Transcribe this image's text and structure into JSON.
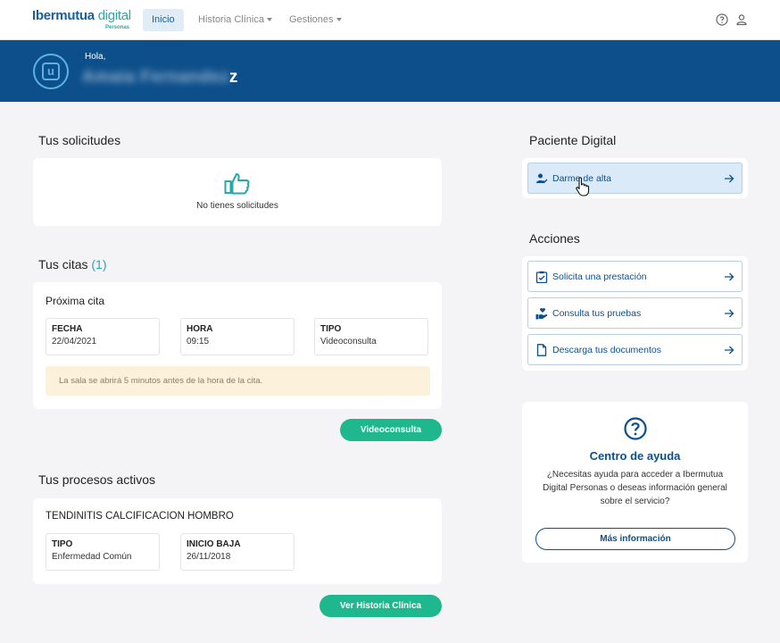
{
  "nav": {
    "logo_brand": "Ibermutua",
    "logo_digital": "digital",
    "logo_sub": "Personas",
    "items": [
      {
        "label": "Inicio",
        "active": true
      },
      {
        "label": "Historia Clínica"
      },
      {
        "label": "Gestiones"
      }
    ],
    "icons": [
      "help-circle-icon",
      "user-icon"
    ]
  },
  "banner": {
    "greeting": "Hola,",
    "name_blurred": "Amaia Fernandez",
    "name_visible_tail": "z"
  },
  "solicitudes": {
    "title": "Tus solicitudes",
    "empty_text": "No tienes solicitudes",
    "icon": "thumbs-up-icon"
  },
  "citas": {
    "title": "Tus citas",
    "count": "(1)",
    "next_title": "Próxima cita",
    "fields": [
      {
        "label": "FECHA",
        "value": "22/04/2021"
      },
      {
        "label": "HORA",
        "value": "09:15"
      },
      {
        "label": "TIPO",
        "value": "Videoconsulta"
      }
    ],
    "notice": "La sala se abrirá 5 minutos antes de la hora de la cita.",
    "button": "Videoconsulta"
  },
  "procesos": {
    "title": "Tus procesos activos",
    "process_name": "TENDINITIS CALCIFICACION HOMBRO",
    "fields": [
      {
        "label": "TIPO",
        "value": "Enfermedad Común"
      },
      {
        "label": "INICIO BAJA",
        "value": "26/11/2018"
      }
    ],
    "button": "Ver Historia Clínica"
  },
  "paciente": {
    "title": "Paciente Digital",
    "button": "Darme de alta"
  },
  "acciones": {
    "title": "Acciones",
    "items": [
      {
        "label": "Solicita una prestación",
        "icon": "clipboard-check-icon"
      },
      {
        "label": "Consulta tus pruebas",
        "icon": "hand-heart-icon"
      },
      {
        "label": "Descarga tus documentos",
        "icon": "document-icon"
      }
    ]
  },
  "ayuda": {
    "title": "Centro de ayuda",
    "text_lines": [
      "¿Necesitas ayuda para acceder a Ibermutua",
      "Digital Personas o deseas información general",
      "sobre el servicio?"
    ],
    "button": "Más información"
  },
  "colors": {
    "primary": "#0d4f8b",
    "accent": "#2aa7a8",
    "button_green": "#1fb88e",
    "notice_bg": "#fcf2dc"
  }
}
